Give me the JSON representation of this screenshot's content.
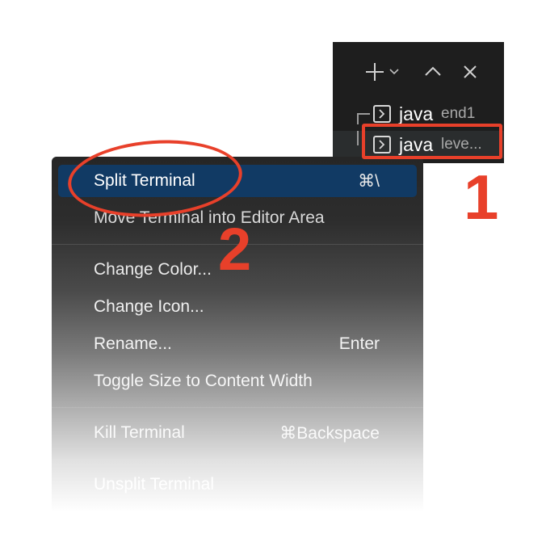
{
  "terminal_panel": {
    "actions": {
      "add_icon": "plus-icon",
      "dropdown_icon": "chevron-down-icon",
      "maximize_icon": "chevron-up-icon",
      "close_icon": "close-icon"
    },
    "terminals": [
      {
        "name": "java",
        "description": "end1",
        "icon": "terminal-icon"
      },
      {
        "name": "java",
        "description": "leve...",
        "icon": "terminal-icon",
        "selected": true
      }
    ]
  },
  "context_menu": {
    "items": [
      {
        "label": "Split Terminal",
        "shortcut": "⌘\\",
        "highlighted": true
      },
      {
        "label": "Move Terminal into Editor Area",
        "shortcut": ""
      },
      {
        "label": "Change Color...",
        "shortcut": ""
      },
      {
        "label": "Change Icon...",
        "shortcut": ""
      },
      {
        "label": "Rename...",
        "shortcut": "Enter"
      },
      {
        "label": "Toggle Size to Content Width",
        "shortcut": ""
      },
      {
        "label": "Kill Terminal",
        "shortcut": "⌘Backspace"
      },
      {
        "label": "Unsplit Terminal",
        "shortcut": ""
      }
    ]
  },
  "annotations": {
    "step_1": "1",
    "step_2": "2",
    "color": "#e8402a"
  },
  "colors": {
    "panel_bg": "#1e1e1e",
    "menu_highlight": "#113a64"
  }
}
